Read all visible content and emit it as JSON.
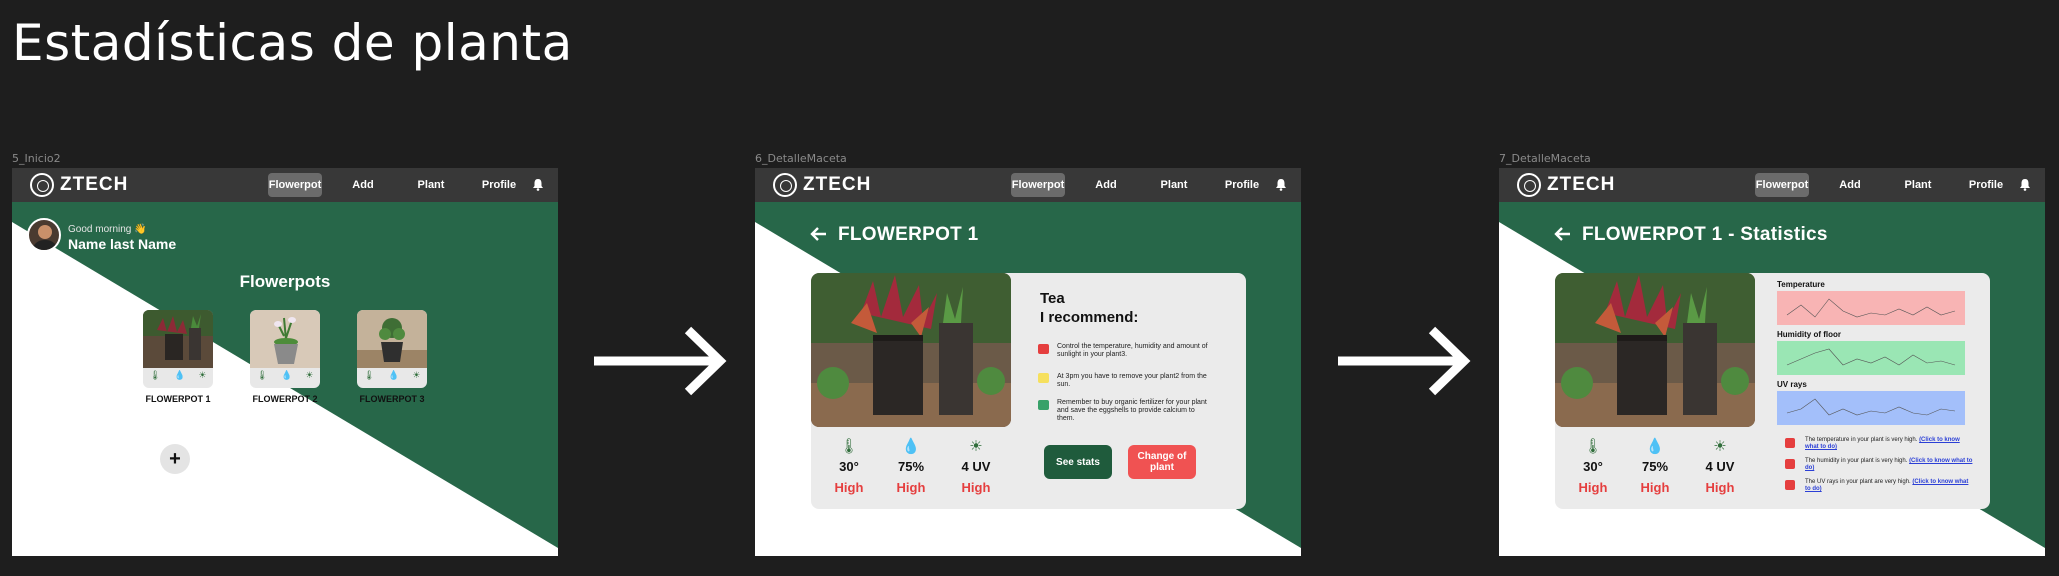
{
  "page_title": "Estadísticas de planta",
  "frames": [
    {
      "label": "5_Inicio2"
    },
    {
      "label": "6_DetalleMaceta"
    },
    {
      "label": "7_DetalleMaceta"
    }
  ],
  "brand": {
    "name": "ZTECH"
  },
  "nav": {
    "items": [
      "Flowerpot",
      "Add",
      "Plant",
      "Profile"
    ],
    "active": "Flowerpot"
  },
  "home": {
    "greeting": "Good morning 👋",
    "user_name": "Name last Name",
    "section_title": "Flowerpots",
    "pots": [
      "FLOWERPOT 1",
      "FLOWERPOT 2",
      "FLOWERPOT 3"
    ],
    "add_label": "+"
  },
  "detail": {
    "title": "FLOWERPOT 1",
    "plant_name": "Tea",
    "recommend_label": "I recommend:",
    "recommendations": [
      "Control the temperature, humidity and amount of sunlight in your plant3.",
      "At 3pm you have to remove your plant2 from the sun.",
      "Remember to buy organic fertilizer for your plant and save the eggshells to provide calcium to them."
    ],
    "stats": [
      {
        "value": "30°",
        "level": "High",
        "icon": "thermometer-icon"
      },
      {
        "value": "75%",
        "level": "High",
        "icon": "water-drops-icon"
      },
      {
        "value": "4 UV",
        "level": "High",
        "icon": "sun-icon"
      }
    ],
    "see_stats_label": "See stats",
    "change_plant_label": "Change of plant"
  },
  "statistics": {
    "title": "FLOWERPOT 1 - Statistics",
    "charts": [
      {
        "label": "Temperature",
        "color": "#f8b4b4"
      },
      {
        "label": "Humidity of floor",
        "color": "#9ae6b4"
      },
      {
        "label": "UV rays",
        "color": "#a3bffa"
      }
    ],
    "alerts": [
      {
        "text": "The temperature in your plant is very high. ",
        "link": "(Click to know what to do)"
      },
      {
        "text": "The humidity in your plant is very high. ",
        "link": "(Click to know what to do)"
      },
      {
        "text": "The UV rays in your plant are very high. ",
        "link": "(Click to know what to do)"
      }
    ]
  },
  "colors": {
    "green": "#276749",
    "dark_green": "#1f5b3c",
    "danger": "#e53e3e",
    "nav": "#383838"
  }
}
